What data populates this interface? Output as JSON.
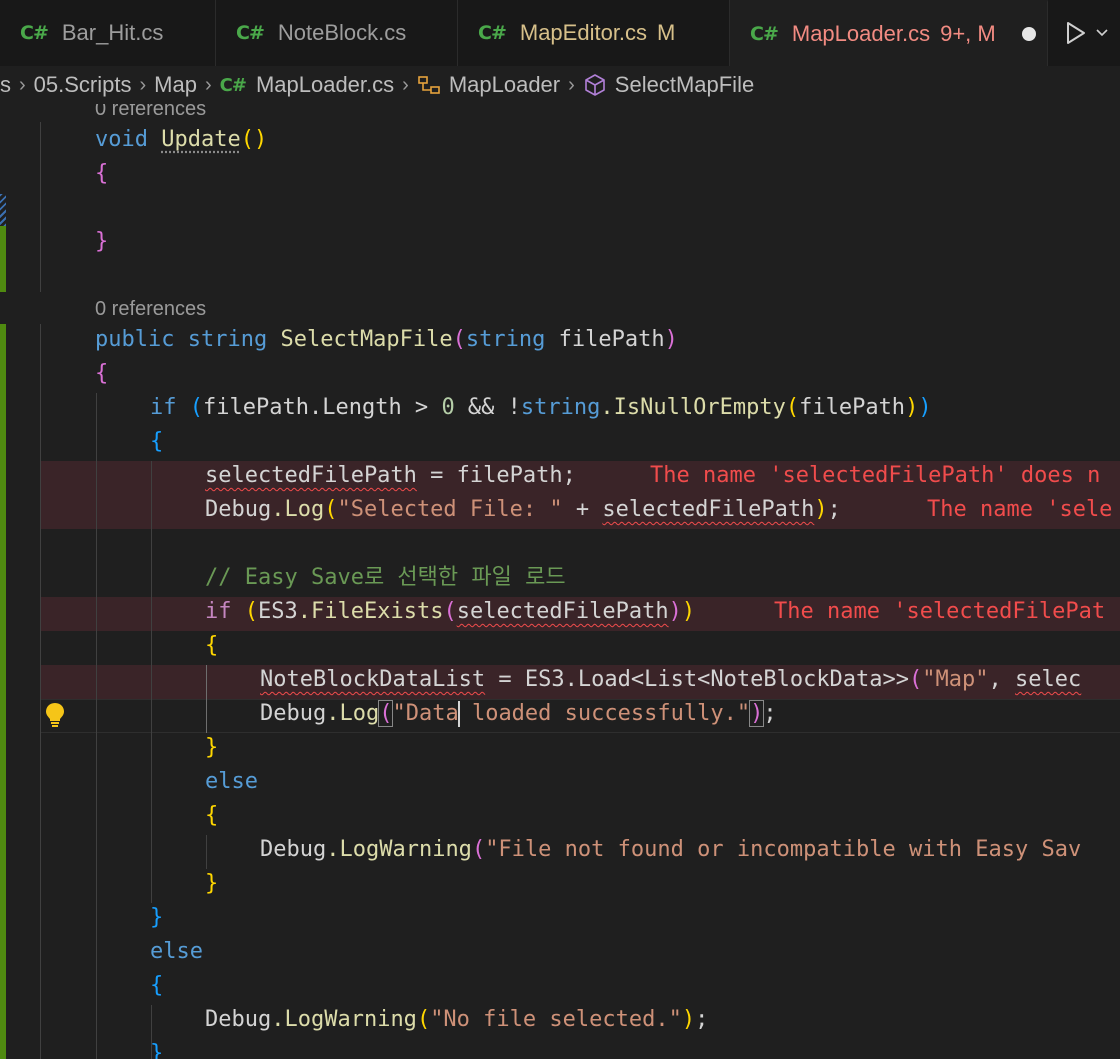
{
  "tabs": [
    {
      "icon": "C#",
      "label": "Bar_Hit.cs",
      "status": ""
    },
    {
      "icon": "C#",
      "label": "NoteBlock.cs",
      "status": ""
    },
    {
      "icon": "C#",
      "label": "MapEditor.cs",
      "status": "M"
    },
    {
      "icon": "C#",
      "label": "MapLoader.cs",
      "status": "9+, M"
    }
  ],
  "breadcrumb": {
    "parent": "s",
    "folder1": "05.Scripts",
    "folder2": "Map",
    "file_icon": "C#",
    "file": "MapLoader.cs",
    "class": "MapLoader",
    "method": "SelectMapFile"
  },
  "codelens": {
    "update_refs": "0 references",
    "select_refs": "0 references"
  },
  "code": {
    "void": "void",
    "update_name": "Update",
    "parens": "()",
    "open": "{",
    "close": "}",
    "public": "public",
    "string": "string",
    "select_name": "SelectMapFile",
    "param_type": "string",
    "param_name": "filePath",
    "if": "if",
    "filePath": "filePath",
    "length": ".Length",
    "gt": " > ",
    "zero": "0",
    "and": " && ",
    "not": "!",
    "string_type": "string",
    "isnull": ".IsNullOrEmpty",
    "selectedFilePath": "selectedFilePath",
    "assign": " = ",
    "semi": ";",
    "debug": "Debug",
    "log": ".Log",
    "log_str": "\"Selected File: \"",
    "plus": " + ",
    "comment": "// Easy Save로 선택한 파일 로드",
    "es3": "ES3",
    "file_exists": ".FileExists",
    "list_var": "NoteBlockDataList",
    "es3_load": "ES3.Load<List<NoteBlockData>>",
    "map_str": "\"Map\"",
    "comma": ", ",
    "selec": "selec",
    "data_str_a": "\"Data",
    "data_str_b": " loaded successfully.\"",
    "else": "else",
    "logwarning": ".LogWarning",
    "warn1": "\"File not found or incompatible with Easy Sav",
    "warn2": "\"No file selected.\""
  },
  "errors": {
    "e1": "The name 'selectedFilePath' does n",
    "e2": "The name 'sele",
    "e3": "The name 'selectedFilePat"
  },
  "colors": {
    "keyword": "#569cd6",
    "control": "#c586c0",
    "function": "#dcdcaa",
    "string": "#ce9178",
    "number": "#b5cea8",
    "comment": "#6a9955",
    "error": "#f14c4c",
    "modified": "#d7c08a",
    "csharp_icon": "#4aa84a"
  }
}
